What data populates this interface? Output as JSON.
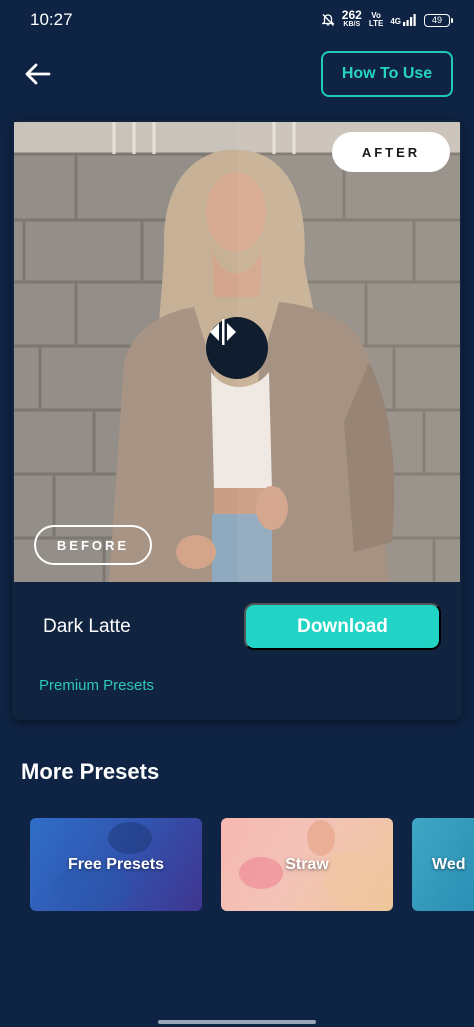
{
  "status_bar": {
    "time": "10:27",
    "net_speed": "262",
    "net_unit": "KB/S",
    "volte": "Vo\nLTE",
    "network": "4G",
    "battery": "49"
  },
  "header": {
    "back_icon": "arrow-left-icon",
    "how_to_use_label": "How To Use"
  },
  "preview": {
    "after_label": "AFTER",
    "before_label": "BEFORE",
    "compare_icon": "compare-slider-icon"
  },
  "preset": {
    "name": "Dark Latte",
    "download_label": "Download",
    "category": "Premium Presets"
  },
  "more": {
    "title": "More Presets",
    "items": [
      {
        "label": "Free Presets"
      },
      {
        "label": "Straw"
      },
      {
        "label": "Wed"
      }
    ]
  },
  "colors": {
    "background": "#0f2444",
    "accent": "#21d4c5",
    "card": "#10233f"
  }
}
